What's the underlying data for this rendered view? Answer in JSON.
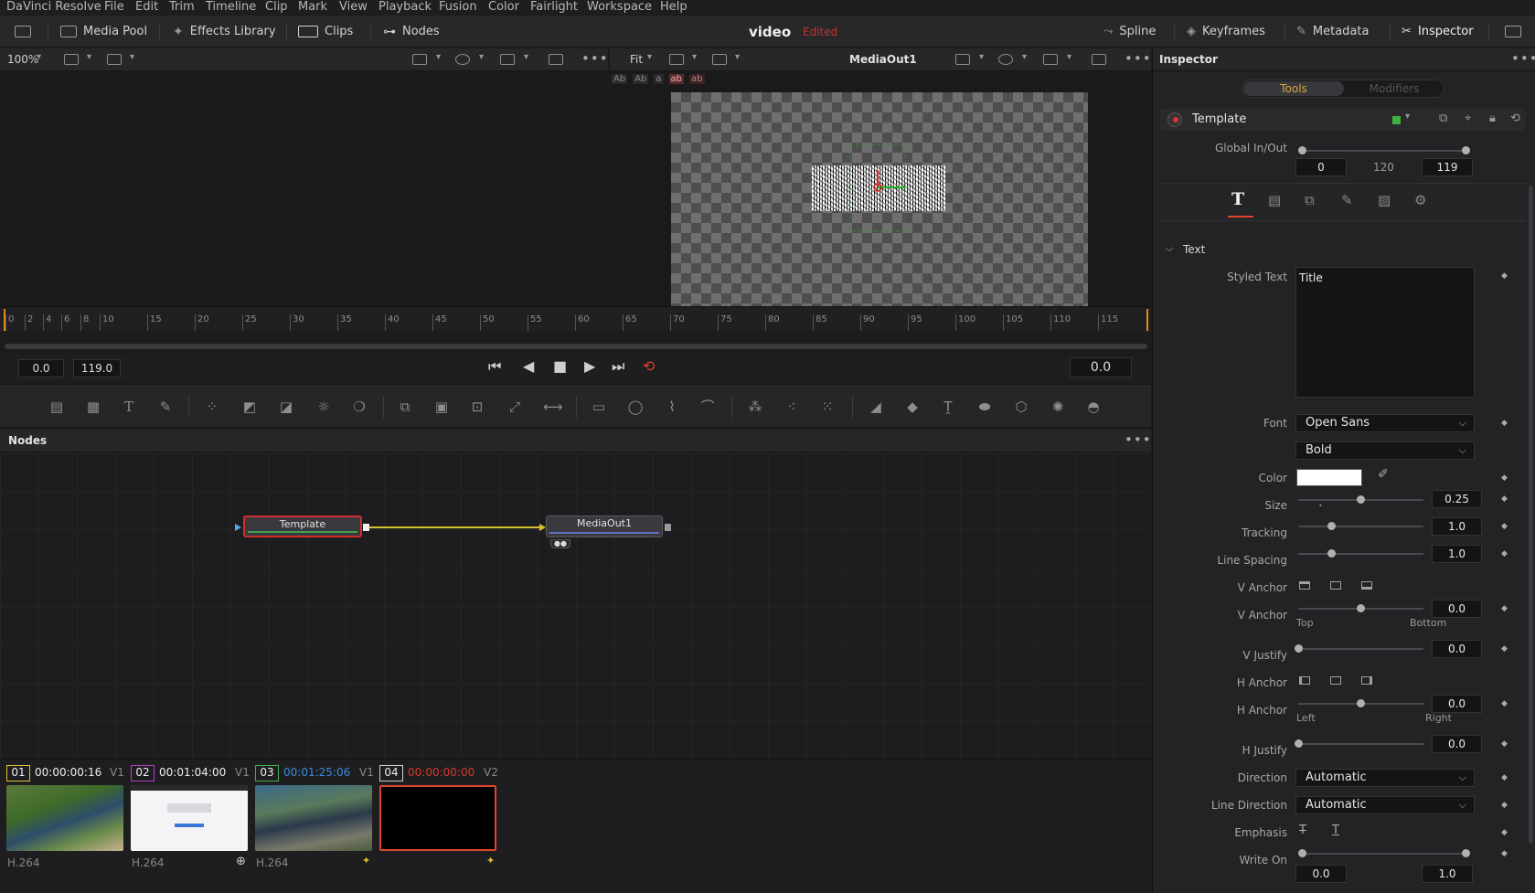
{
  "menubar": {
    "app": "DaVinci Resolve",
    "items": [
      "File",
      "Edit",
      "Trim",
      "Timeline",
      "Clip",
      "Mark",
      "View",
      "Playback",
      "Fusion",
      "Color",
      "Fairlight",
      "Workspace",
      "Help"
    ]
  },
  "toolbar": {
    "media_pool": "Media Pool",
    "effects_library": "Effects Library",
    "clips": "Clips",
    "nodes": "Nodes",
    "project_title": "video",
    "project_status": "Edited",
    "spline": "Spline",
    "keyframes": "Keyframes",
    "metadata": "Metadata",
    "inspector": "Inspector"
  },
  "viewer_left": {
    "zoom": "100%"
  },
  "viewer_right": {
    "fit": "Fit",
    "title": "MediaOut1",
    "text_tools": [
      "Ab",
      "Ab",
      "a",
      "ab",
      "ab"
    ]
  },
  "ruler": {
    "ticks": [
      "0",
      "2",
      "4",
      "6",
      "8",
      "10",
      "15",
      "20",
      "25",
      "30",
      "35",
      "40",
      "45",
      "50",
      "55",
      "60",
      "65",
      "70",
      "75",
      "80",
      "85",
      "90",
      "95",
      "100",
      "105",
      "110",
      "115"
    ]
  },
  "transport": {
    "in": "0.0",
    "out": "119.0",
    "current": "0.0"
  },
  "nodes": {
    "header": "Nodes",
    "node1": "Template",
    "node2": "MediaOut1"
  },
  "clips": [
    {
      "num": "01",
      "tc": "00:00:00:16",
      "track": "V1",
      "codec": "H.264",
      "color": "#e0c030"
    },
    {
      "num": "02",
      "tc": "00:01:04:00",
      "track": "V1",
      "codec": "H.264",
      "color": "#b040c0"
    },
    {
      "num": "03",
      "tc": "00:01:25:06",
      "track": "V1",
      "codec": "H.264",
      "color": "#40b050"
    },
    {
      "num": "04",
      "tc": "00:00:00:00",
      "track": "V2",
      "codec": "",
      "color": "#d0d0d0"
    }
  ],
  "inspector": {
    "title": "Inspector",
    "tab_tools": "Tools",
    "tab_modifiers": "Modifiers",
    "tool_name": "Template",
    "global_inout_label": "Global In/Out",
    "global_in": "0",
    "global_mid": "120",
    "global_out": "119",
    "section_text": "Text",
    "styled_text_label": "Styled Text",
    "styled_text_value": "Title",
    "font_label": "Font",
    "font_value": "Open Sans",
    "style_value": "Bold",
    "color_label": "Color",
    "size_label": "Size",
    "size_value": "0.25",
    "tracking_label": "Tracking",
    "tracking_value": "1.0",
    "line_spacing_label": "Line Spacing",
    "line_spacing_value": "1.0",
    "v_anchor_label": "V Anchor",
    "v_anchor_label2": "V Anchor",
    "v_anchor_value": "0.0",
    "top_label": "Top",
    "bottom_label": "Bottom",
    "v_justify_label": "V Justify",
    "v_justify_value": "0.0",
    "h_anchor_label": "H Anchor",
    "h_anchor_label2": "H Anchor",
    "h_anchor_value": "0.0",
    "left_label": "Left",
    "right_label": "Right",
    "h_justify_label": "H Justify",
    "h_justify_value": "0.0",
    "direction_label": "Direction",
    "direction_value": "Automatic",
    "line_direction_label": "Line Direction",
    "line_direction_value": "Automatic",
    "emphasis_label": "Emphasis",
    "write_on_label": "Write On",
    "write_on_start": "0.0",
    "write_on_end": "1.0"
  }
}
